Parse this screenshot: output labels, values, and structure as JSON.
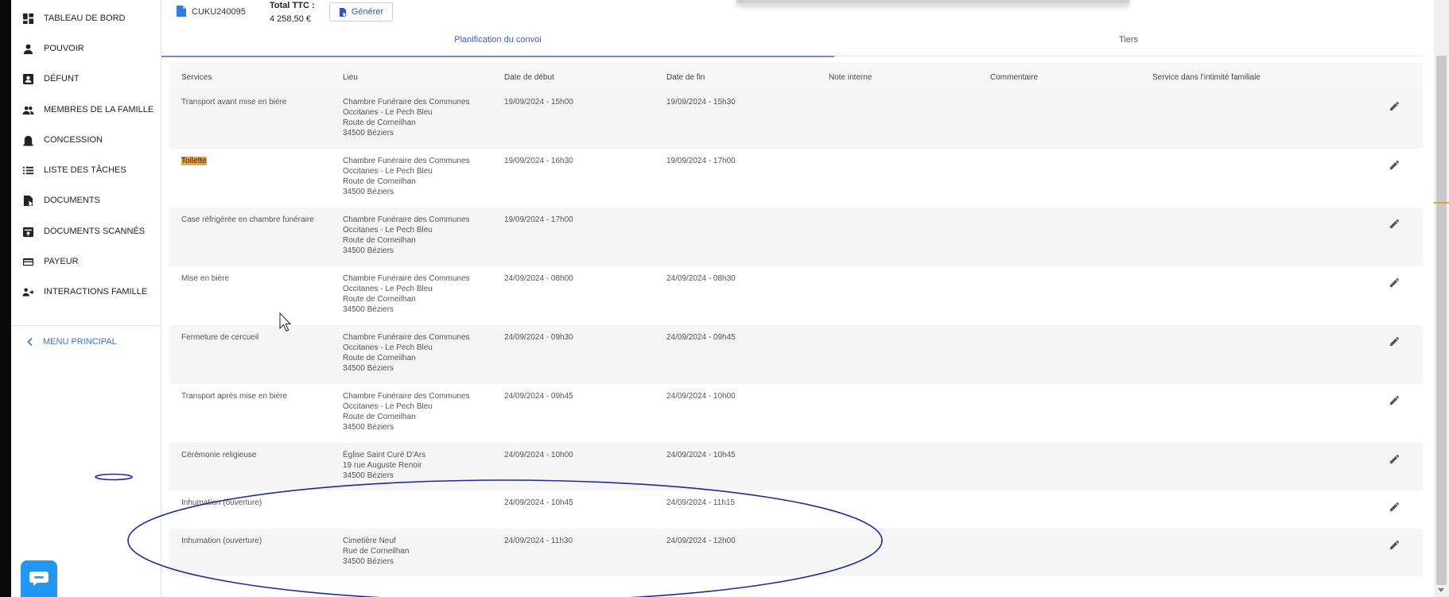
{
  "sidebar": {
    "items": [
      {
        "label": "TABLEAU DE BORD",
        "icon": "dashboard-icon"
      },
      {
        "label": "POUVOIR",
        "icon": "person-icon"
      },
      {
        "label": "DÉFUNT",
        "icon": "contact-card-icon"
      },
      {
        "label": "MEMBRES DE LA FAMILLE",
        "icon": "people-icon"
      },
      {
        "label": "CONCESSION",
        "icon": "tombstone-icon"
      },
      {
        "label": "LISTE DES TÂCHES",
        "icon": "list-icon"
      },
      {
        "label": "DOCUMENTS",
        "icon": "document-icon"
      },
      {
        "label": "DOCUMENTS SCANNÉS",
        "icon": "scan-icon"
      },
      {
        "label": "PAYEUR",
        "icon": "credit-card-icon"
      },
      {
        "label": "INTERACTIONS FAMILLE",
        "icon": "interactions-icon"
      }
    ],
    "menu_principal": "MENU PRINCIPAL"
  },
  "header": {
    "dossier_number": "CUKU240095",
    "total_label": "Total TTC :",
    "total_value": "4 258,50 €",
    "generate_label": "Générer"
  },
  "tabs": [
    "Planification du convoi",
    "Tiers"
  ],
  "table": {
    "columns": [
      "Services",
      "Lieu",
      "Date de début",
      "Date de fin",
      "Note interne",
      "Commentaire",
      "Service dans l'intimité familiale"
    ],
    "rows": [
      {
        "service": "Transport avant mise en bière",
        "lieu": [
          "Chambre Funéraire des Communes",
          "Occitanes - Le Pech Bleu",
          "Route de Corneilhan",
          "34500 Béziers"
        ],
        "debut": "19/09/2024 - 15h00",
        "fin": "19/09/2024 - 15h30"
      },
      {
        "service": "Toilette",
        "lieu": [
          "Chambre Funéraire des Communes",
          "Occitanes - Le Pech Bleu",
          "Route de Corneilhan",
          "34500 Béziers"
        ],
        "debut": "19/09/2024 - 16h30",
        "fin": "19/09/2024 - 17h00"
      },
      {
        "service": "Case réfrigérée en chambre funéraire",
        "lieu": [
          "Chambre Funéraire des Communes",
          "Occitanes - Le Pech Bleu",
          "Route de Corneilhan",
          "34500 Béziers"
        ],
        "debut": "19/09/2024 - 17h00",
        "fin": ""
      },
      {
        "service": "Mise en bière",
        "lieu": [
          "Chambre Funéraire des Communes",
          "Occitanes - Le Pech Bleu",
          "Route de Corneilhan",
          "34500 Béziers"
        ],
        "debut": "24/09/2024 - 08h00",
        "fin": "24/09/2024 - 08h30"
      },
      {
        "service": "Fermeture de cercueil",
        "lieu": [
          "Chambre Funéraire des Communes",
          "Occitanes - Le Pech Bleu",
          "Route de Corneilhan",
          "34500 Béziers"
        ],
        "debut": "24/09/2024 - 09h30",
        "fin": "24/09/2024 - 09h45"
      },
      {
        "service": "Transport après mise en bière",
        "lieu": [
          "Chambre Funéraire des Communes",
          "Occitanes - Le Pech Bleu",
          "Route de Corneilhan",
          "34500 Béziers"
        ],
        "debut": "24/09/2024 - 09h45",
        "fin": "24/09/2024 - 10h00"
      },
      {
        "service": "Cérémonie religieuse",
        "lieu": [
          "Église Saint Curé D'Ars",
          "19 rue Auguste Renoir",
          "34500 Béziers"
        ],
        "debut": "24/09/2024 - 10h00",
        "fin": "24/09/2024 - 10h45"
      },
      {
        "service": "Inhumation (ouverture)",
        "lieu": [],
        "debut": "24/09/2024 - 10h45",
        "fin": "24/09/2024 - 11h15"
      },
      {
        "service": "Inhumation (ouverture)",
        "lieu": [
          "Cimetière Neuf",
          "Rue de Corneilhan",
          "34500 Béziers"
        ],
        "debut": "24/09/2024 - 11h30",
        "fin": "24/09/2024 - 12h00"
      }
    ]
  },
  "colors": {
    "accent": "#3b5cc4",
    "chat": "#2196f3",
    "highlight": "#f0a33a",
    "annotation": "#1e2a9c"
  }
}
